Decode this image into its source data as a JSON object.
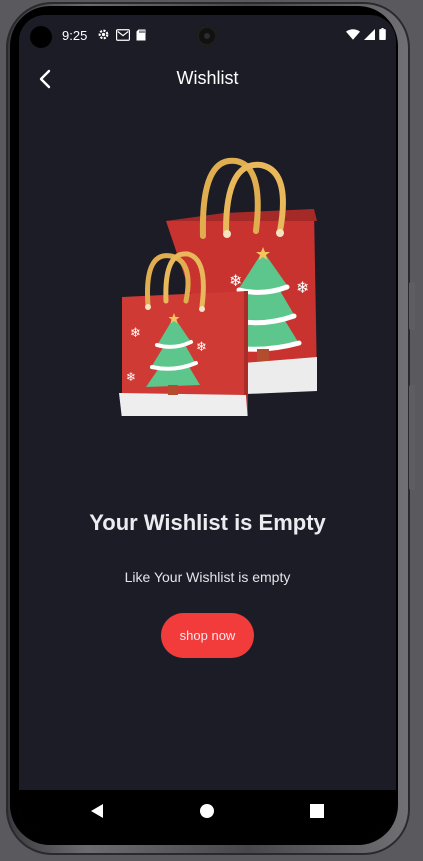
{
  "status_bar": {
    "time": "9:25",
    "left_icons": [
      "gear-icon",
      "mail-icon",
      "sd-card-icon"
    ],
    "right_icons": [
      "wifi-icon",
      "signal-icon",
      "battery-icon"
    ]
  },
  "app_bar": {
    "title": "Wishlist",
    "back_icon": "chevron-left-icon"
  },
  "empty_state": {
    "illustration": "christmas-shopping-bags",
    "title": "Your Wishlist is Empty",
    "subtitle": "Like Your Wishlist is empty",
    "button_label": "shop now"
  },
  "colors": {
    "background": "#1c1c27",
    "accent": "#f23b3b",
    "text": "#ececf0"
  },
  "nav_bar": {
    "buttons": [
      "back-triangle-icon",
      "home-circle-icon",
      "recents-square-icon"
    ]
  }
}
